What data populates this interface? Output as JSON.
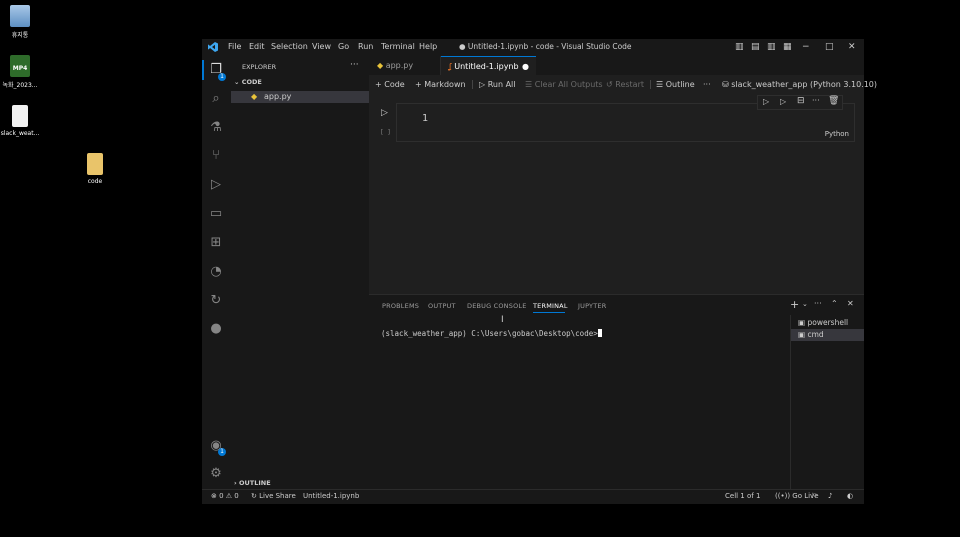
{
  "desktop": {
    "icons": [
      {
        "label": "휴지통",
        "icon": "recycle-bin-icon"
      },
      {
        "label": "녹화_2023...",
        "icon": "mp4-video-icon",
        "badge": "MP4"
      },
      {
        "label": "slack_weat...",
        "icon": "python-file-icon"
      },
      {
        "label": "code",
        "icon": "folder-icon"
      }
    ]
  },
  "window": {
    "title": "● Untitled-1.ipynb - code - Visual Studio Code",
    "menu": [
      "File",
      "Edit",
      "Selection",
      "View",
      "Go",
      "Run",
      "Terminal",
      "Help"
    ]
  },
  "activity_bar": {
    "explorer_badge": "1",
    "accounts_badge": "1"
  },
  "sidebar": {
    "header": "EXPLORER",
    "folder": "CODE",
    "files": [
      "app.py"
    ],
    "outline": "OUTLINE"
  },
  "tabs": [
    {
      "label": "app.py",
      "active": false
    },
    {
      "label": "Untitled-1.ipynb",
      "active": true
    }
  ],
  "notebook_toolbar": {
    "code": "Code",
    "markdown": "Markdown",
    "run_all": "Run All",
    "clear_outputs": "Clear All Outputs",
    "restart": "Restart",
    "outline": "Outline",
    "more": "···",
    "kernel": "slack_weather_app (Python 3.10.10)"
  },
  "cell": {
    "line_number": "1",
    "exec_count": "[ ]",
    "language": "Python"
  },
  "panel": {
    "tabs": [
      "PROBLEMS",
      "OUTPUT",
      "DEBUG CONSOLE",
      "TERMINAL",
      "JUPYTER"
    ],
    "active_tab": "TERMINAL",
    "terminal_line": "(slack_weather_app) C:\\Users\\gobac\\Desktop\\code>",
    "terminals": [
      "powershell",
      "cmd"
    ]
  },
  "statusbar": {
    "errors": "0",
    "warnings": "0",
    "live_share": "Live Share",
    "file": "Untitled-1.ipynb",
    "cell_position": "Cell 1 of 1",
    "go_live": "Go Live"
  },
  "colors": {
    "accent": "#0078d4",
    "python_yellow": "#e8c33a",
    "tab_dirty": "#ffffff"
  }
}
